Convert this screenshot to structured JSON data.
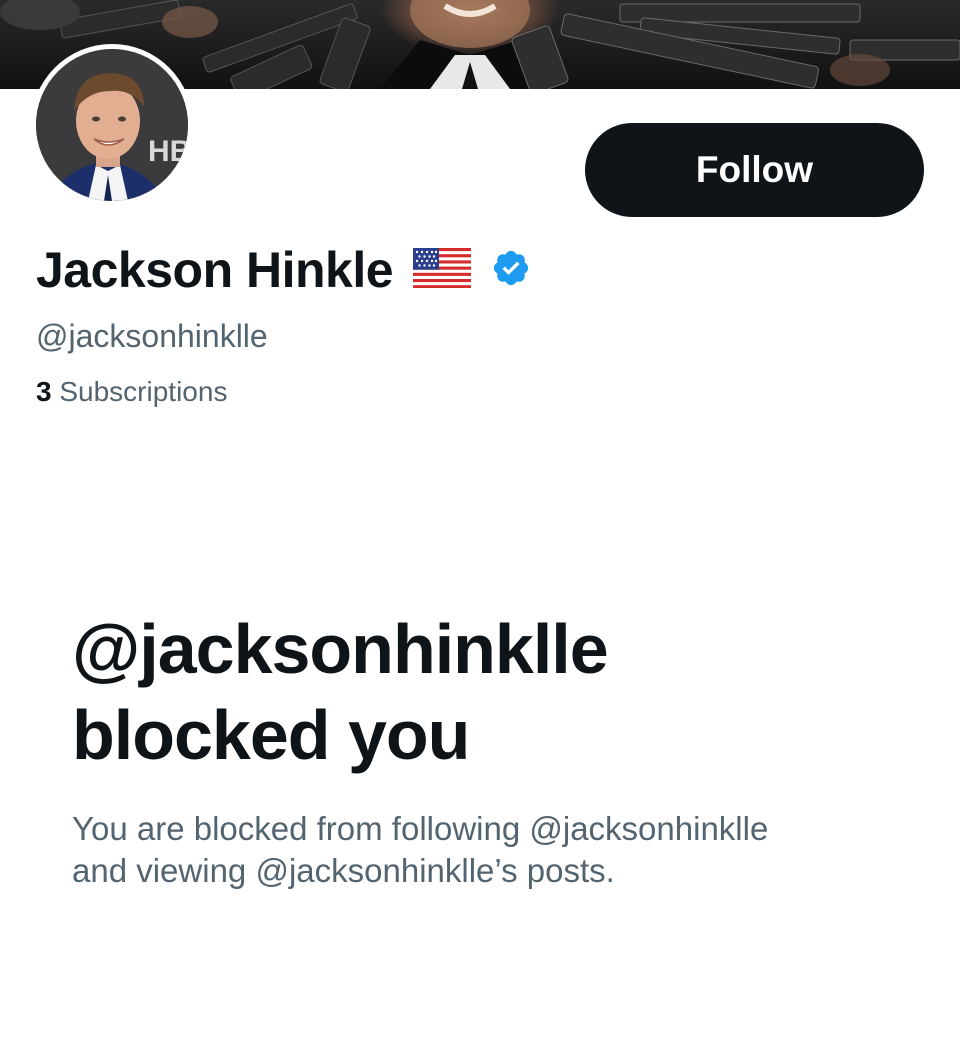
{
  "profile": {
    "display_name": "Jackson Hinkle",
    "handle": "@jacksonhinklle",
    "subscriptions_count": "3",
    "subscriptions_label": "Subscriptions",
    "flag_icon": "us-flag-icon",
    "verified_icon": "verified-badge-icon"
  },
  "actions": {
    "follow_label": "Follow"
  },
  "blocked": {
    "title_line1": "@jacksonhinklle",
    "title_line2": "blocked you",
    "description_line1": "You are blocked from following @jacksonhinklle",
    "description_line2": "and viewing @jacksonhinklle’s posts."
  },
  "colors": {
    "primary_text": "#0f1419",
    "secondary_text": "#536471",
    "verified_blue": "#1d9bf0",
    "button_bg": "#0f1419"
  }
}
